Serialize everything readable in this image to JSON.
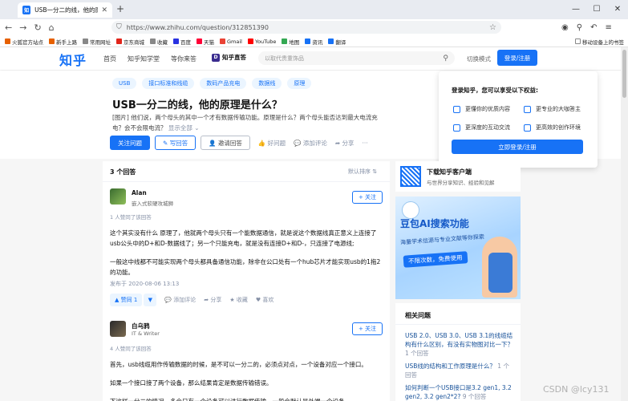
{
  "browser": {
    "tab_title": "USB一分二的线，他的原理是什",
    "tab_close": "✕",
    "new_tab": "+",
    "url": "https://www.zhihu.com/question/312851390",
    "bookmarks": [
      {
        "label": "火狐官方站点",
        "color": "#e66000"
      },
      {
        "label": "新手上路",
        "color": "#e66000"
      },
      {
        "label": "常用网址",
        "color": "#888"
      },
      {
        "label": "京东商城",
        "color": "#e1251b"
      },
      {
        "label": "收藏",
        "color": "#888"
      },
      {
        "label": "百度",
        "color": "#2932e1"
      },
      {
        "label": "天猫",
        "color": "#ff0036"
      },
      {
        "label": "Gmail",
        "color": "#ea4335"
      },
      {
        "label": "YouTube",
        "color": "#ff0000"
      },
      {
        "label": "地图",
        "color": "#34a853"
      },
      {
        "label": "资讯",
        "color": "#1772f6"
      },
      {
        "label": "翻译",
        "color": "#1772f6"
      }
    ],
    "bookmarks_right": "移动设备上的书签"
  },
  "header": {
    "logo": "知乎",
    "nav": [
      "首页",
      "知乎知学堂",
      "等你来答"
    ],
    "zhida": "知乎直答",
    "search_placeholder": "以取代贵重饰品",
    "switch_mode": "切换模式",
    "login": "登录/注册"
  },
  "question": {
    "tags": [
      "USB",
      "接口标准和线缆",
      "数码产品充电",
      "数据线",
      "原理"
    ],
    "title": "USB一分二的线，他的原理是什么？",
    "desc_line1": "[图片] 他们说，两个母头的其中一个才有数据传输功能。原理是什么？两个母头能否达到最大电流充",
    "desc_line2": "电？会不会限电流？",
    "show_all": "显示全部 ⌄",
    "follow": "关注问题",
    "write": "✎ 写回答",
    "invite": "👤 邀请回答",
    "good": "好问题",
    "comment": "添加评论",
    "share": "分享",
    "more": "···"
  },
  "popup": {
    "title": "登录知乎，您可以享受以下权益:",
    "perks": [
      "更懂你的优质内容",
      "更专业的大咖答主",
      "更深度的互动交流",
      "更高效的创作环境"
    ],
    "button": "立即登录/注册"
  },
  "answers": {
    "count": "3 个回答",
    "sort": "默认排序 ⇅",
    "items": [
      {
        "name": "Alan",
        "bio": "嵌入式软硬攻城狮",
        "follow": "+ 关注",
        "votes": "1 人赞同了该回答",
        "text1": "这个其实没有什么 原理了，他就两个母头只有一个能数据通信，就是说这个数据线真正意义上连接了usb公头中的D+和D-数据线了；另一个只能充电，就是没有连接D+和D-，只连接了电源线;",
        "text2": "一般这中线都不可能实现两个母头都具备通信功能，除非在公口处有一个hub芯片才能实现usb的1拖2的功能。",
        "date": "发布于 2020-08-06 13:13",
        "upvote": "▲ 赞同 1",
        "downvote": "▼",
        "comment": "添加评论",
        "share": "分享",
        "collect": "收藏",
        "like": "喜欢"
      },
      {
        "name": "白乌鸦",
        "bio": "IT & Writer",
        "follow": "+ 关注",
        "votes": "4 人赞同了该回答",
        "text1": "首先，usb线缆用作传输数据的时候，是不可以一分二的，必须点对点，一个设备对应一个接口。",
        "text2": "如果一个接口接了两个设备，那么结果肯定是数据传输错误。",
        "text3": "下这样一分二的情况，多会只有一个设备可以进行数据传输，一般会默认是外端一个设备。"
      }
    ]
  },
  "sidebar": {
    "download_title": "下载知乎客户端",
    "download_sub": "与世界分享知识、经验和见解",
    "banner_title": "豆包AI搜索功能",
    "banner_sub": "海量学术信源与专业文献等你探索",
    "banner_btn": "不限次数，免费使用",
    "related_title": "相关问题",
    "related": [
      {
        "q": "USB 2.0、USB 3.0、USB 3.1的线缆结构有什么区别，有没有实物图对比一下？",
        "n": "1 个回答"
      },
      {
        "q": "USB线的结构和工作原理是什么？",
        "n": "1 个回答"
      },
      {
        "q": "如何判断一个USB接口是3.2 gen1, 3.2 gen2, 3.2 gen2*2?",
        "n": "9 个回答"
      }
    ]
  },
  "watermark": "CSDN @lcy131"
}
